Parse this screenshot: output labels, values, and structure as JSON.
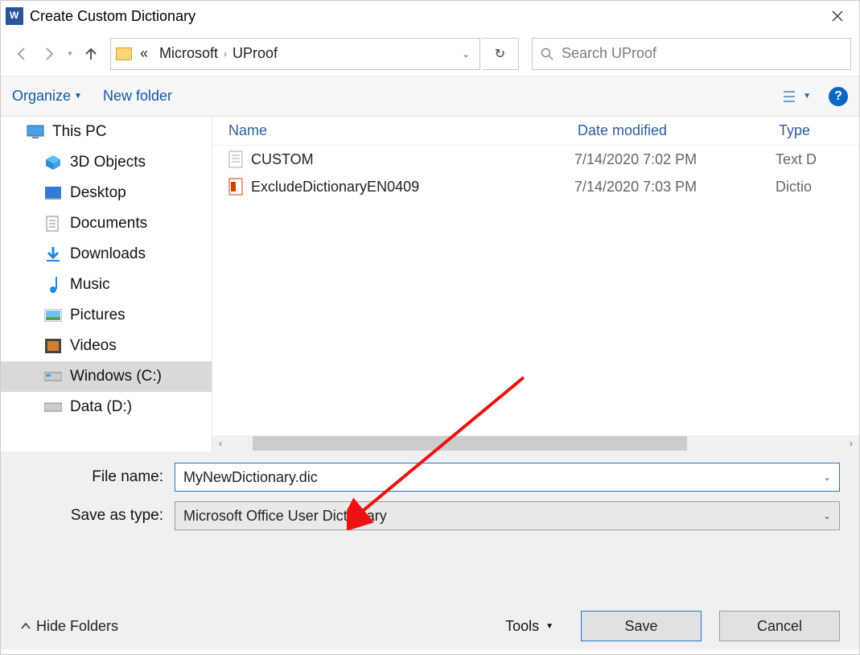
{
  "title": "Create Custom Dictionary",
  "breadcrumb": {
    "ellipsis": "«",
    "part1": "Microsoft",
    "part2": "UProof"
  },
  "search": {
    "placeholder": "Search UProof"
  },
  "toolbar": {
    "organize": "Organize",
    "newfolder": "New folder"
  },
  "columns": {
    "name": "Name",
    "date": "Date modified",
    "type": "Type"
  },
  "tree": {
    "thispc": "This PC",
    "items": [
      "3D Objects",
      "Desktop",
      "Documents",
      "Downloads",
      "Music",
      "Pictures",
      "Videos",
      "Windows (C:)",
      "Data (D:)"
    ]
  },
  "files": [
    {
      "name": "CUSTOM",
      "date": "7/14/2020 7:02 PM",
      "type": "Text D"
    },
    {
      "name": "ExcludeDictionaryEN0409",
      "date": "7/14/2020 7:03 PM",
      "type": "Dictio"
    }
  ],
  "labels": {
    "filename": "File name:",
    "saveas": "Save as type:"
  },
  "values": {
    "filename": "MyNewDictionary.dic",
    "saveas": "Microsoft Office User Dictionary"
  },
  "footer": {
    "hide": "Hide Folders",
    "tools": "Tools",
    "save": "Save",
    "cancel": "Cancel"
  },
  "help": "?"
}
